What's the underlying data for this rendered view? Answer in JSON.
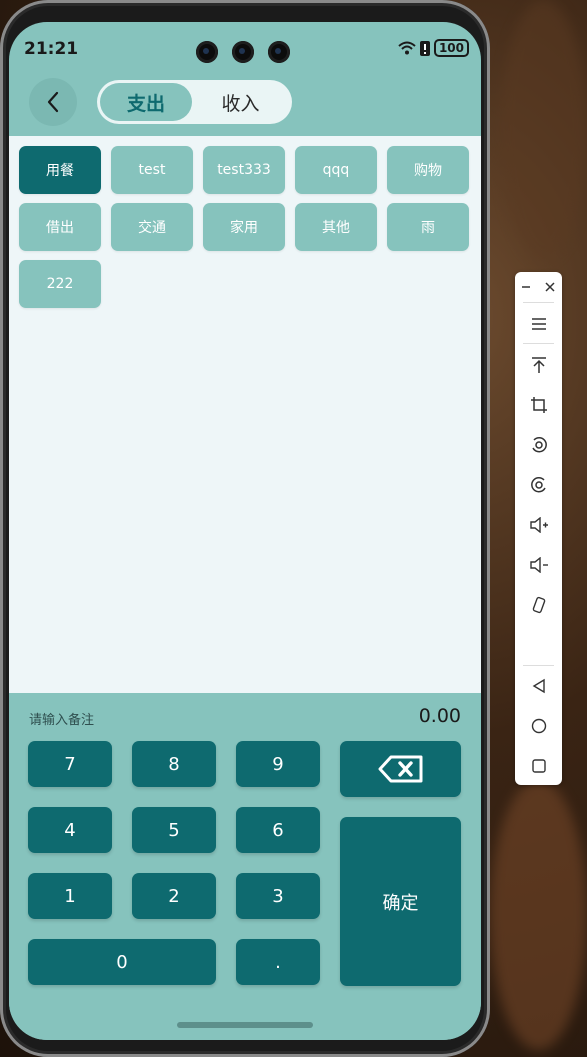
{
  "status_bar": {
    "time": "21:21",
    "battery": "100"
  },
  "header": {
    "tabs": [
      {
        "label": "支出",
        "active": true
      },
      {
        "label": "收入",
        "active": false
      }
    ]
  },
  "categories": [
    {
      "label": "用餐",
      "selected": true
    },
    {
      "label": "test",
      "selected": false
    },
    {
      "label": "test333",
      "selected": false
    },
    {
      "label": "qqq",
      "selected": false
    },
    {
      "label": "购物",
      "selected": false
    },
    {
      "label": "借出",
      "selected": false
    },
    {
      "label": "交通",
      "selected": false
    },
    {
      "label": "家用",
      "selected": false
    },
    {
      "label": "其他",
      "selected": false
    },
    {
      "label": "雨",
      "selected": false
    },
    {
      "label": "222",
      "selected": false
    }
  ],
  "input": {
    "note_placeholder": "请输入备注",
    "amount": "0.00"
  },
  "keypad": {
    "digits": [
      "7",
      "8",
      "9",
      "4",
      "5",
      "6",
      "1",
      "2",
      "3",
      "0",
      "."
    ],
    "confirm_label": "确定",
    "backspace_icon": "backspace-icon"
  },
  "toolbar": {
    "icons": [
      "minimize-icon",
      "close-icon",
      "menu-icon",
      "pin-top-icon",
      "crop-icon",
      "rotate-left-icon",
      "rotate-right-icon",
      "volume-up-icon",
      "volume-down-icon",
      "shake-icon",
      "back-nav-icon",
      "home-nav-icon",
      "recents-nav-icon"
    ]
  },
  "colors": {
    "primary": "#0e6a6f",
    "secondary": "#86c3bd",
    "content_bg": "#eef6f8"
  }
}
